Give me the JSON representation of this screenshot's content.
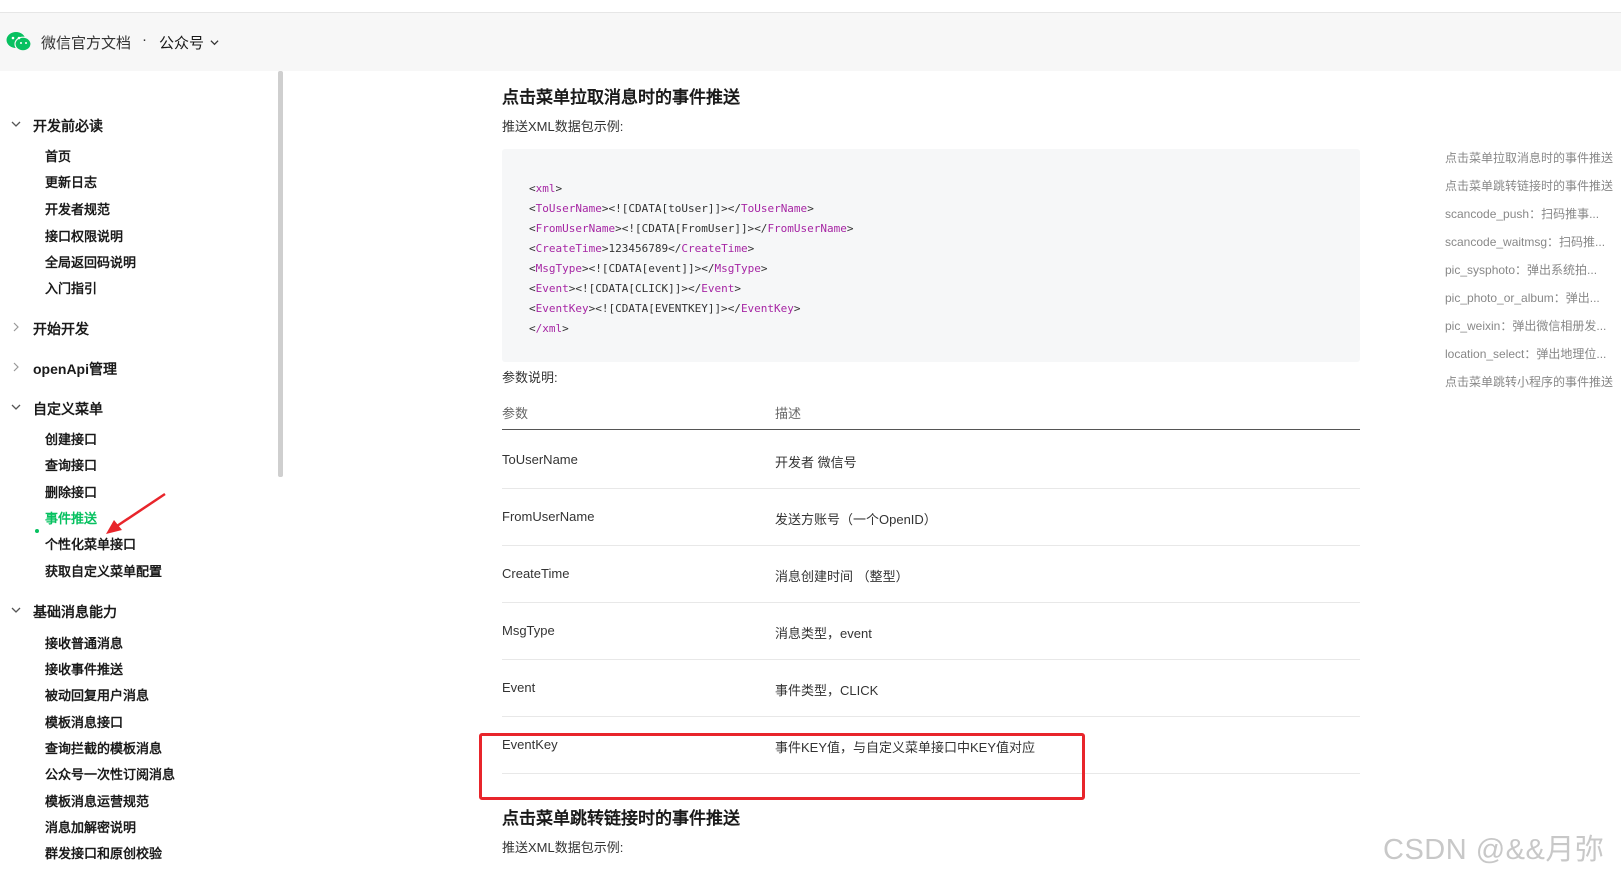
{
  "header": {
    "brand": "微信官方文档",
    "separator": "·",
    "product": "公众号"
  },
  "sidebar": {
    "groups": [
      {
        "label": "开发前必读",
        "expanded": true,
        "items": [
          "首页",
          "更新日志",
          "开发者规范",
          "接口权限说明",
          "全局返回码说明",
          "入门指引"
        ]
      },
      {
        "label": "开始开发",
        "expanded": false,
        "items": []
      },
      {
        "label": "openApi管理",
        "expanded": false,
        "items": []
      },
      {
        "label": "自定义菜单",
        "expanded": true,
        "items": [
          "创建接口",
          "查询接口",
          "删除接口",
          "事件推送",
          "个性化菜单接口",
          "获取自定义菜单配置"
        ]
      },
      {
        "label": "基础消息能力",
        "expanded": true,
        "items": [
          "接收普通消息",
          "接收事件推送",
          "被动回复用户消息",
          "模板消息接口",
          "查询拦截的模板消息",
          "公众号一次性订阅消息",
          "模板消息运营规范",
          "消息加解密说明",
          "群发接口和原创校验"
        ]
      }
    ],
    "active_item": "事件推送"
  },
  "main": {
    "section1_title": "点击菜单拉取消息时的事件推送",
    "xml_intro": "推送XML数据包示例:",
    "code_lines": [
      {
        "open": "xml",
        "inner": "",
        "close": ""
      },
      {
        "open": "ToUserName",
        "inner": "<![CDATA[toUser]]>",
        "close": "ToUserName"
      },
      {
        "open": "FromUserName",
        "inner": "<![CDATA[FromUser]]>",
        "close": "FromUserName"
      },
      {
        "open": "CreateTime",
        "inner": "123456789",
        "close": "CreateTime"
      },
      {
        "open": "MsgType",
        "inner": "<![CDATA[event]]>",
        "close": "MsgType"
      },
      {
        "open": "Event",
        "inner": "<![CDATA[CLICK]]>",
        "close": "Event"
      },
      {
        "open": "EventKey",
        "inner": "<![CDATA[EVENTKEY]]>",
        "close": "EventKey"
      },
      {
        "open": "/xml",
        "inner": "",
        "close": ""
      }
    ],
    "params_intro": "参数说明:",
    "table": {
      "headers": [
        "参数",
        "描述"
      ],
      "rows": [
        [
          "ToUserName",
          "开发者 微信号"
        ],
        [
          "FromUserName",
          "发送方账号（一个OpenID）"
        ],
        [
          "CreateTime",
          "消息创建时间 （整型）"
        ],
        [
          "MsgType",
          "消息类型，event"
        ],
        [
          "Event",
          "事件类型，CLICK"
        ],
        [
          "EventKey",
          "事件KEY值，与自定义菜单接口中KEY值对应"
        ]
      ]
    },
    "section2_title": "点击菜单跳转链接时的事件推送",
    "xml_intro2": "推送XML数据包示例:"
  },
  "toc": [
    "点击菜单拉取消息时的事件推送",
    "点击菜单跳转链接时的事件推送",
    "scancode_push：扫码推事...",
    "scancode_waitmsg：扫码推...",
    "pic_sysphoto：弹出系统拍...",
    "pic_photo_or_album：弹出...",
    "pic_weixin：弹出微信相册发...",
    "location_select：弹出地理位...",
    "点击菜单跳转小程序的事件推送"
  ],
  "watermark": "CSDN @&&月弥",
  "colors": {
    "accent": "#07c160",
    "highlight_box": "#e8252b",
    "xml_tag": "#a626a4"
  }
}
